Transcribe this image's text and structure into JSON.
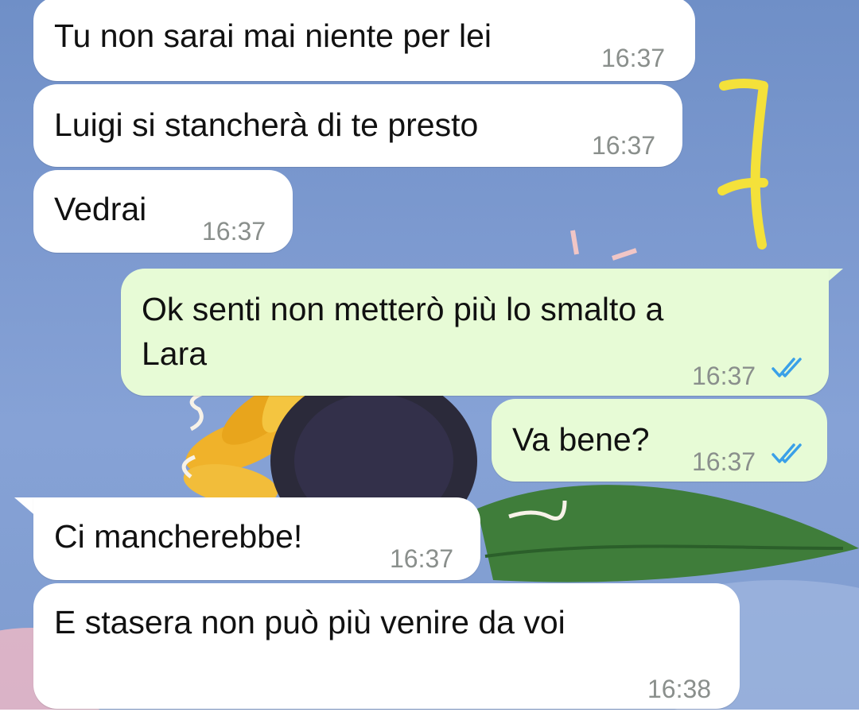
{
  "messages": [
    {
      "direction": "incoming",
      "text": "Tu non sarai mai niente per lei",
      "time": "16:37"
    },
    {
      "direction": "incoming",
      "text": "Luigi si stancherà di te presto",
      "time": "16:37"
    },
    {
      "direction": "incoming",
      "text": "Vedrai",
      "time": "16:37"
    },
    {
      "direction": "outgoing",
      "text_line1": "Ok senti non metterò più lo smalto a",
      "text_line2": "Lara",
      "time": "16:37",
      "status": "read"
    },
    {
      "direction": "outgoing",
      "text": "Va bene?",
      "time": "16:37",
      "status": "read"
    },
    {
      "direction": "incoming",
      "text": "Ci mancherebbe!",
      "time": "16:37"
    },
    {
      "direction": "incoming",
      "text": "E stasera non può più venire da voi",
      "time": "16:38"
    }
  ],
  "annotation": {
    "text": "7",
    "color": "#f4e13a"
  },
  "colors": {
    "incoming_bubble": "#ffffff",
    "outgoing_bubble": "#e7fbd6",
    "read_ticks": "#3aa0e8",
    "timestamp": "#8a8f8c"
  }
}
